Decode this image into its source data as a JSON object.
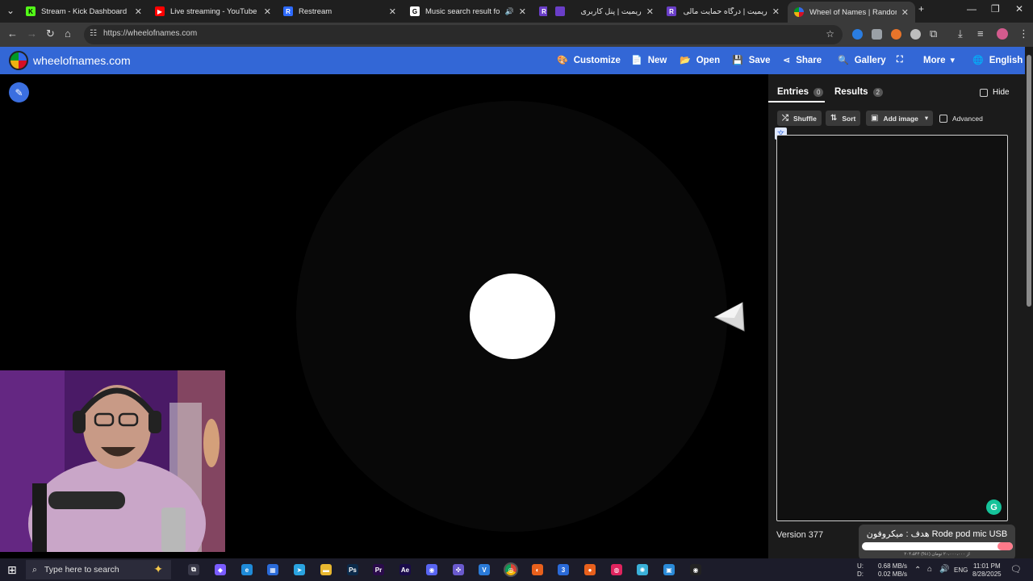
{
  "browser": {
    "tabs": [
      {
        "title": "Stream - Kick Dashboard",
        "icon": "kick-icon",
        "color": "#53fc18",
        "glyph": "K",
        "active": false
      },
      {
        "title": "Live streaming - YouTube Studio",
        "icon": "youtube-icon",
        "color": "#ff0000",
        "glyph": "▶",
        "active": false
      },
      {
        "title": "Restream",
        "icon": "restream-icon",
        "color": "#2e6bff",
        "glyph": "R",
        "active": false
      },
      {
        "title": "Music search result for funk",
        "icon": "search-icon",
        "color": "#ffffff",
        "glyph": "G",
        "active": false,
        "audio": true
      },
      {
        "title": "",
        "icon": "app-icon",
        "color": "#6a3ec8",
        "glyph": "R",
        "active": false
      },
      {
        "title": "ریمیت | پنل کاربری",
        "icon": "reymit-icon",
        "color": "#6a3ec8",
        "glyph": "",
        "active": false
      },
      {
        "title": "ریمیت | درگاه حمایت مالی از min",
        "icon": "reymit-icon",
        "color": "#6a3ec8",
        "glyph": "R",
        "active": false
      },
      {
        "title": "Wheel of Names | Random name",
        "icon": "wheel-icon",
        "color": "#d50f25",
        "glyph": "",
        "active": true
      }
    ],
    "url": "https://wheelofnames.com"
  },
  "app": {
    "title": "wheelofnames.com",
    "menu": [
      {
        "label": "Customize",
        "icon": "palette-icon",
        "glyph": "🎨"
      },
      {
        "label": "New",
        "icon": "file-icon",
        "glyph": "📄"
      },
      {
        "label": "Open",
        "icon": "folder-icon",
        "glyph": "📂"
      },
      {
        "label": "Save",
        "icon": "save-icon",
        "glyph": "💾"
      },
      {
        "label": "Share",
        "icon": "share-icon",
        "glyph": "⋖"
      },
      {
        "label": "Gallery",
        "icon": "search-icon",
        "glyph": "🔍"
      },
      {
        "label": "",
        "icon": "fullscreen-icon",
        "glyph": "⛶"
      },
      {
        "label": "More",
        "icon": "chevron-down-icon",
        "glyph": "▾"
      },
      {
        "label": "English",
        "icon": "globe-icon",
        "glyph": "🌐"
      }
    ]
  },
  "panel": {
    "entries_label": "Entries",
    "entries_count": "0",
    "results_label": "Results",
    "results_count": "2",
    "hide_label": "Hide",
    "shuffle_label": "Shuffle",
    "sort_label": "Sort",
    "add_image_label": "Add image",
    "advanced_label": "Advanced",
    "version": "Version 377"
  },
  "overlay": {
    "goal_text": "هدف : میکروفون Rode pod mic USB",
    "goal_progress": 0.1,
    "goal_sub": "۲۰۴،۵۴۴ از ۲۰،۰۰۰،۰۰۰ تومان (۱%)"
  },
  "taskbar": {
    "search_placeholder": "Type here to search",
    "upload": "0.68 MB/s",
    "download": "0.02 MB/s",
    "upload_label": "U:",
    "download_label": "D:",
    "language": "ENG",
    "time": "11:01 PM",
    "date": "8/28/2025"
  },
  "colors": {
    "brand_blue": "#3367d6",
    "panel_bg": "#1b1b1b",
    "goal_fill": "#ff7a8a"
  }
}
